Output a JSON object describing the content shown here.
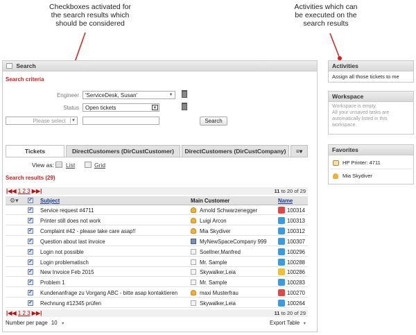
{
  "annotations": {
    "checkbox_note": [
      "Checkboxes activated for",
      "the search results which",
      "should be considered"
    ],
    "activities_note": [
      "Activities which can",
      "be executed on the",
      "search results"
    ]
  },
  "search_panel": {
    "title": "Search",
    "criteria_label": "Search criteria",
    "engineer_label": "Engineer",
    "engineer_value": "'ServiceDesk, Susan'",
    "status_label": "Status",
    "status_value": "Open tickets",
    "please_select": "Please select",
    "search_button": "Search"
  },
  "tabs": [
    "Tickets",
    "DirectCustomers (DirCustCustomer)",
    "DirectCustomers (DirCustCompany)"
  ],
  "view_as": {
    "label": "View as:",
    "list": "List",
    "grid": "Grid"
  },
  "results": {
    "title": "Search results (29)",
    "pages": "1 2 3",
    "range_from": "11",
    "range_text": "to 20 of 29",
    "columns": {
      "subject": "Subject",
      "customer": "Main Customer",
      "name": "Name"
    },
    "rows": [
      {
        "subject": "Service request #4711",
        "customer": "Arnold Schwarzenegger",
        "cust_icon": "person",
        "name": "100314",
        "status_color": "#e04848"
      },
      {
        "subject": "Printer still does not work",
        "customer": "Luigi Arcon",
        "cust_icon": "person",
        "name": "100313",
        "status_color": "#3a9be0"
      },
      {
        "subject": "Complaint #42 - please take care asap!!",
        "customer": "Mia Skydiver",
        "cust_icon": "person",
        "name": "100312",
        "status_color": "#3a9be0"
      },
      {
        "subject": "Question about last invoice",
        "customer": "MyNewSpaceCompany 999",
        "cust_icon": "company",
        "name": "100307",
        "status_color": "#3a9be0"
      },
      {
        "subject": "Login not possible",
        "customer": "Soellner,Manfred",
        "cust_icon": "none",
        "name": "100296",
        "status_color": "#3a9be0"
      },
      {
        "subject": "Login problematisch",
        "customer": "Mr. Sample",
        "cust_icon": "none",
        "name": "100288",
        "status_color": "#3a9be0"
      },
      {
        "subject": "New Invoice Feb 2015",
        "customer": "Skywalker,Leia",
        "cust_icon": "none",
        "name": "100286",
        "status_color": "#f0c030"
      },
      {
        "subject": "Problem 1",
        "customer": "Mr. Sample",
        "cust_icon": "none",
        "name": "100283",
        "status_color": "#3a9be0"
      },
      {
        "subject": "Kundenanfrage zu Vorgang ABC - bitte asap kontaktieren",
        "customer": "maxi Musterfrau",
        "cust_icon": "person",
        "name": "100270",
        "status_color": "#e04848"
      },
      {
        "subject": "Rechnung #12345 prüfen",
        "customer": "Skywalker,Leia",
        "cust_icon": "none",
        "name": "100264",
        "status_color": "#3a9be0"
      }
    ],
    "per_page_label": "Number per page",
    "per_page_value": "10",
    "export": "Export Table"
  },
  "activities": {
    "title": "Activities",
    "item": "Assign all those tickets to me"
  },
  "workspace": {
    "title": "Workspace",
    "text": [
      "Workspace is empty.",
      "All your unsaved tasks are",
      "automatically listed in this",
      "workspace."
    ]
  },
  "favorites": {
    "title": "Favorites",
    "items": [
      {
        "label": "HP Printer: 4711",
        "icon": "printer"
      },
      {
        "label": "Mia Skydiver",
        "icon": "person"
      }
    ]
  },
  "colors": {
    "accent_red": "#cc2222",
    "link_blue": "#1a3a8a",
    "header_bg": "#e2e2e2"
  }
}
